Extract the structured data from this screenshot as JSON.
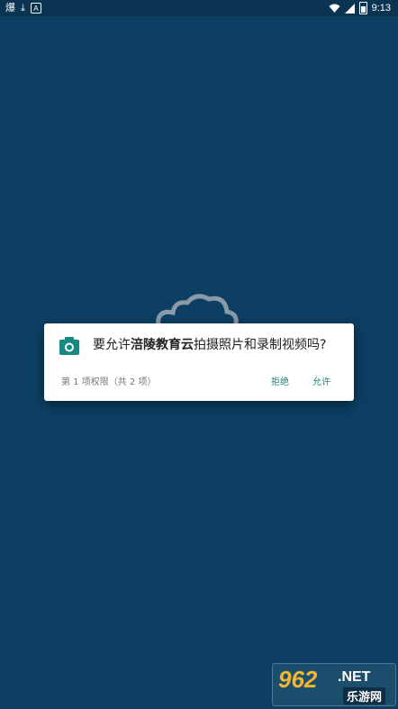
{
  "status_bar": {
    "app_icon_1": "爆",
    "app_icon_2": "⤓",
    "app_icon_3": "A",
    "time": "9:13"
  },
  "dialog": {
    "message_prefix": "要允许",
    "app_name": "涪陵教育云",
    "message_suffix": "拍摄照片和录制视频吗?",
    "permission_count": "第 1 项权限（共 2 项）",
    "deny_label": "拒绝",
    "allow_label": "允许",
    "accent_color": "#168a81",
    "icon": "camera-icon"
  },
  "watermark": {
    "logo_text": "962",
    "domain_text": ".NET",
    "site_name": "乐游网"
  },
  "colors": {
    "background": "#0c3f63",
    "dialog_background": "#ffffff"
  }
}
